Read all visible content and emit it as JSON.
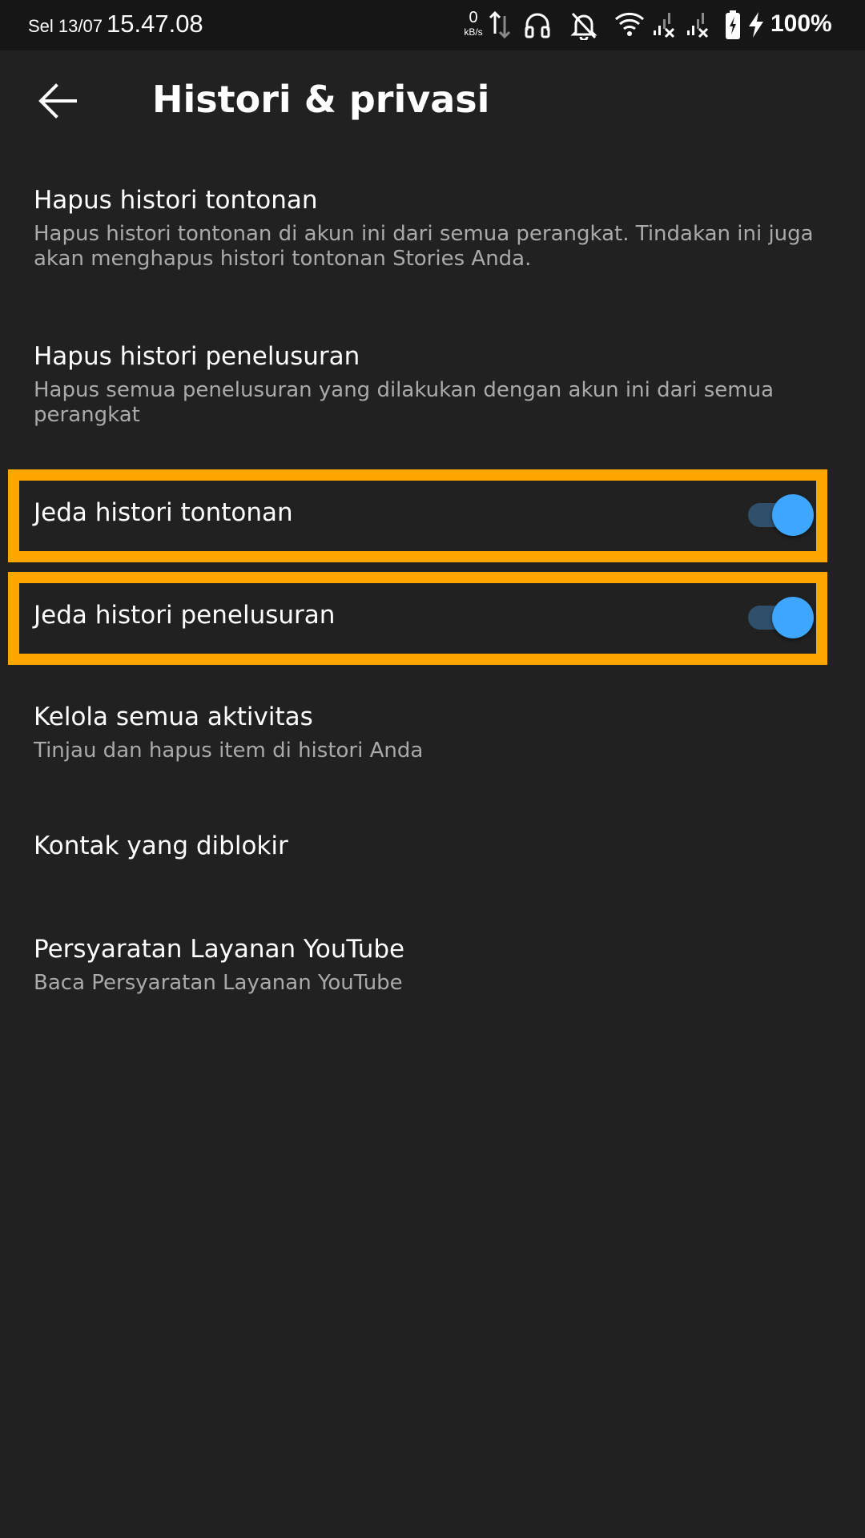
{
  "status_bar": {
    "day": "Sel 13/07",
    "time": "15.47.08",
    "net_speed_value": "0",
    "net_speed_unit": "kB/s",
    "battery_percent": "100%",
    "icons": [
      "data-arrows-icon",
      "headphones-icon",
      "notifications-off-icon",
      "wifi-icon",
      "signal-no-sim-icon",
      "signal-no-sim-icon",
      "battery-charging-icon",
      "charging-bolt-icon"
    ]
  },
  "app_bar": {
    "back_icon": "arrow-left-icon",
    "title": "Histori & privasi"
  },
  "settings": [
    {
      "title": "Hapus histori tontonan",
      "subtitle": "Hapus histori tontonan di akun ini dari semua perangkat. Tindakan ini juga akan menghapus histori tontonan Stories Anda."
    },
    {
      "title": "Hapus histori penelusuran",
      "subtitle": "Hapus semua penelusuran yang dilakukan dengan akun ini dari semua perangkat"
    },
    {
      "title": "Jeda histori tontonan",
      "toggle_on": true
    },
    {
      "title": "Jeda histori penelusuran",
      "toggle_on": true
    },
    {
      "title": "Kelola semua aktivitas",
      "subtitle": "Tinjau dan hapus item di histori Anda"
    },
    {
      "title": "Kontak yang diblokir"
    },
    {
      "title": "Persyaratan Layanan YouTube",
      "subtitle": "Baca Persyaratan Layanan YouTube"
    }
  ],
  "colors": {
    "background": "#212121",
    "status_bar": "#161616",
    "secondary_text": "#aaaaaa",
    "toggle_thumb": "#3ea6ff",
    "toggle_track": "#2f4f6b",
    "highlight": "#ffa600"
  }
}
